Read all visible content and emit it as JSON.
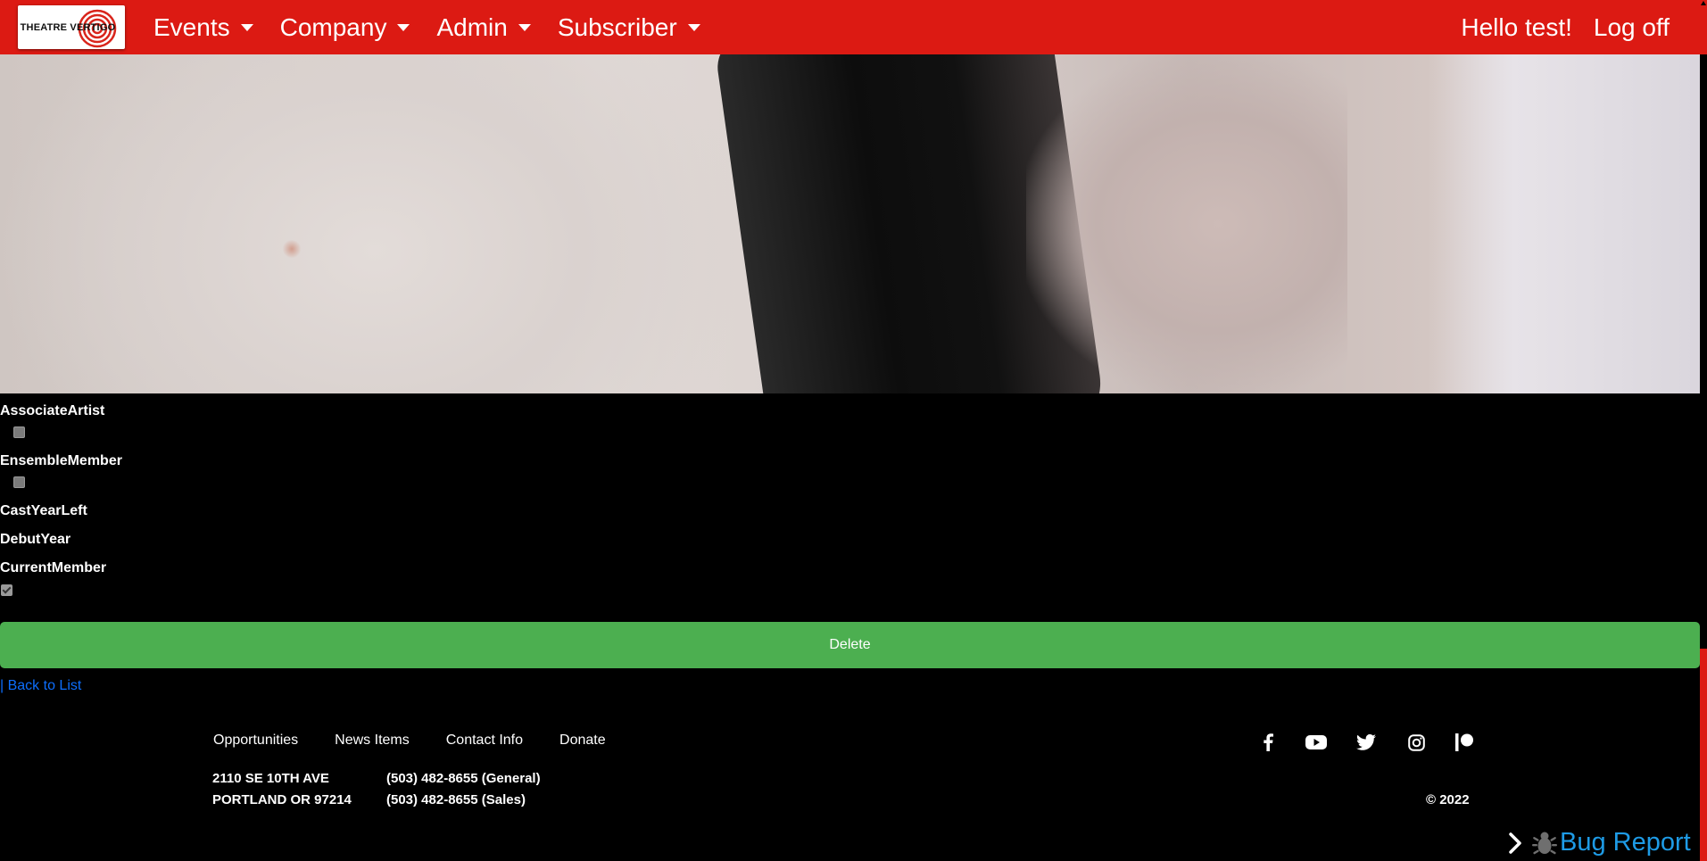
{
  "nav": {
    "logo_text": "THEATRE VERTIGO",
    "menu": [
      {
        "label": "Events"
      },
      {
        "label": "Company"
      },
      {
        "label": "Admin"
      },
      {
        "label": "Subscriber"
      }
    ],
    "greeting": "Hello test!",
    "logoff": "Log off"
  },
  "details": {
    "associate_artist": {
      "label": "AssociateArtist",
      "checked": false
    },
    "ensemble_member": {
      "label": "EnsembleMember",
      "checked": false
    },
    "cast_year_left": {
      "label": "CastYearLeft",
      "value": ""
    },
    "debut_year": {
      "label": "DebutYear",
      "value": ""
    },
    "current_member": {
      "label": "CurrentMember",
      "checked": true
    }
  },
  "actions": {
    "delete_label": "Delete",
    "separator": "|",
    "back_label": "Back to List"
  },
  "footer": {
    "links": [
      "Opportunities",
      "News Items",
      "Contact Info",
      "Donate"
    ],
    "address_line1": "2110 SE 10TH AVE",
    "address_line2": "PORTLAND OR 97214",
    "phone_general": "(503) 482-8655 (General)",
    "phone_sales": "(503) 482-8655 (Sales)",
    "social_icons": [
      "facebook-icon",
      "youtube-icon",
      "twitter-icon",
      "instagram-icon",
      "patreon-icon"
    ],
    "copyright": "© 2022"
  },
  "bug_report": {
    "label": "Bug Report"
  },
  "colors": {
    "nav_red": "#dc1a13",
    "button_green": "#4caf50",
    "link_blue": "#0d6efd",
    "bug_blue": "#1e9be6"
  }
}
